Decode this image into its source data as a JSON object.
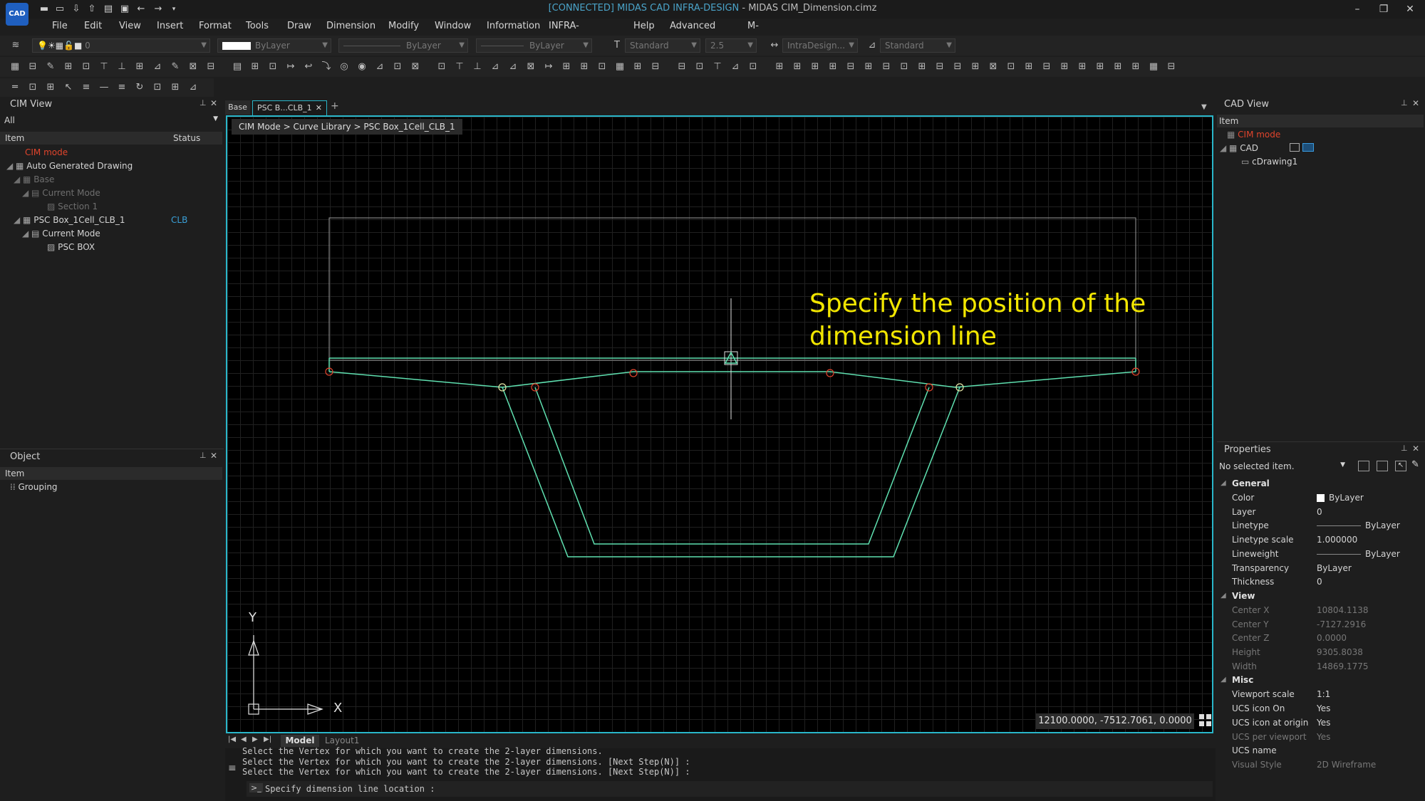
{
  "app": {
    "logo_text": "CAD",
    "title_connected": "[CONNECTED] MIDAS CAD INFRA-DESIGN",
    "title_rest": " - MIDAS CIM_Dimension.cimz"
  },
  "menu": [
    "File",
    "Edit",
    "View",
    "Insert",
    "Format",
    "Tools",
    "Draw",
    "Dimension",
    "Modify",
    "Window",
    "Information",
    "INFRA-DESIGN(I)",
    "Help",
    "Advanced Tool",
    "M-Dream"
  ],
  "toolbar": {
    "layer_value": "0",
    "color_value": "ByLayer",
    "linetype_value": "ByLayer",
    "lineweight_value": "ByLayer",
    "textstyle_value": "Standard",
    "textsize_value": "2.5",
    "dimstyle_value": "IntraDesign...",
    "tablestyle_value": "Standard"
  },
  "cim_view": {
    "title": "CIM View",
    "filter": "All",
    "col_item": "Item",
    "col_status": "Status",
    "rows": [
      {
        "label": "CIM mode",
        "status": ""
      },
      {
        "label": "Auto Generated Drawing",
        "status": ""
      },
      {
        "label": "Base",
        "status": ""
      },
      {
        "label": "Current Mode",
        "status": ""
      },
      {
        "label": "Section 1",
        "status": ""
      },
      {
        "label": "PSC Box_1Cell_CLB_1",
        "status": "CLB"
      },
      {
        "label": "Current Mode",
        "status": ""
      },
      {
        "label": "PSC BOX",
        "status": ""
      }
    ]
  },
  "object_panel": {
    "title": "Object",
    "col_item": "Item",
    "rows": [
      "Grouping"
    ]
  },
  "doc_tabs": [
    "Base",
    "PSC B...CLB_1"
  ],
  "breadcrumb": "CIM Mode > Curve Library > PSC Box_1Cell_CLB_1",
  "canvas": {
    "prompt": [
      "Specify the position of the",
      "dimension line"
    ],
    "coords": "12100.0000, -7512.7061, 0.0000",
    "axis_x": "X",
    "axis_y": "Y"
  },
  "layout_tabs": [
    "Model",
    "Layout1"
  ],
  "command": {
    "history": [
      "Select the Vertex for which you want to create the 2-layer dimensions.",
      "Select the Vertex for which you want to create the 2-layer dimensions. [Next Step(N)] :",
      "Select the Vertex for which you want to create the 2-layer dimensions. [Next Step(N)] :"
    ],
    "prompt": "Specify dimension line location :"
  },
  "cad_view": {
    "title": "CAD View",
    "col_item": "Item",
    "rows": [
      {
        "label": "CIM mode"
      },
      {
        "label": "CAD"
      },
      {
        "label": "cDrawing1"
      }
    ]
  },
  "properties": {
    "title": "Properties",
    "selection": "No selected item.",
    "sections": [
      {
        "name": "General",
        "items": [
          {
            "k": "Color",
            "v": "ByLayer"
          },
          {
            "k": "Layer",
            "v": "0"
          },
          {
            "k": "Linetype",
            "v": "ByLayer"
          },
          {
            "k": "Linetype scale",
            "v": "1.000000"
          },
          {
            "k": "Lineweight",
            "v": "ByLayer"
          },
          {
            "k": "Transparency",
            "v": "ByLayer"
          },
          {
            "k": "Thickness",
            "v": "0"
          }
        ]
      },
      {
        "name": "View",
        "items": [
          {
            "k": "Center X",
            "v": "10804.1138"
          },
          {
            "k": "Center Y",
            "v": "-7127.2916"
          },
          {
            "k": "Center Z",
            "v": "0.0000"
          },
          {
            "k": "Height",
            "v": "9305.8038"
          },
          {
            "k": "Width",
            "v": "14869.1775"
          }
        ]
      },
      {
        "name": "Misc",
        "items": [
          {
            "k": "Viewport scale",
            "v": "1:1"
          },
          {
            "k": "UCS icon On",
            "v": "Yes"
          },
          {
            "k": "UCS icon at origin",
            "v": "Yes"
          },
          {
            "k": "UCS per viewport",
            "v": "Yes"
          },
          {
            "k": "UCS name",
            "v": ""
          },
          {
            "k": "Visual Style",
            "v": "2D Wireframe"
          }
        ]
      }
    ]
  },
  "colors": {
    "accent": "#29b6c9",
    "geometry": "#5fe0b0",
    "prompt": "#f2e600",
    "vertex": "#e0442c",
    "cim_mode": "#e0442c"
  }
}
